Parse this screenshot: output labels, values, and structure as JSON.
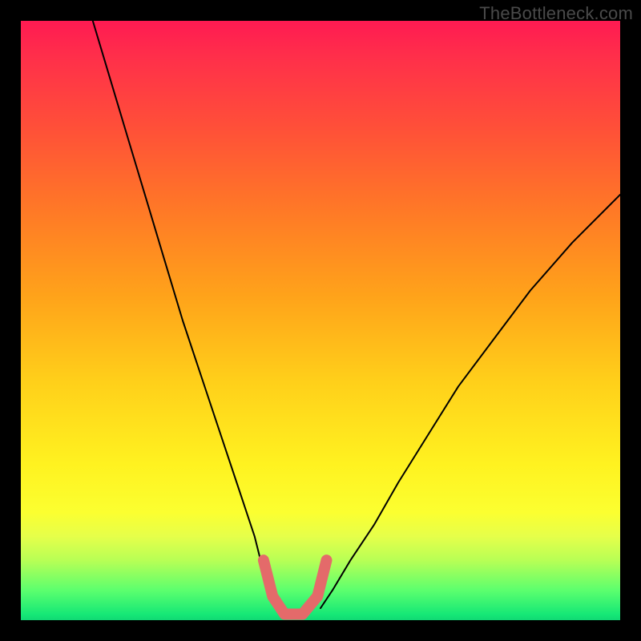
{
  "watermark": "TheBottleneck.com",
  "chart_data": {
    "type": "line",
    "title": "",
    "xlabel": "",
    "ylabel": "",
    "xlim": [
      0,
      100
    ],
    "ylim": [
      0,
      100
    ],
    "grid": false,
    "series": [
      {
        "name": "black-curve-left",
        "color": "#000000",
        "stroke_width": 2,
        "x": [
          12,
          15,
          18,
          21,
          24,
          27,
          30,
          33,
          36,
          39,
          41,
          42.5
        ],
        "values": [
          100,
          90,
          80,
          70,
          60,
          50,
          41,
          32,
          23,
          14,
          6,
          2
        ]
      },
      {
        "name": "black-curve-right",
        "color": "#000000",
        "stroke_width": 2,
        "x": [
          50,
          52,
          55,
          59,
          63,
          68,
          73,
          79,
          85,
          92,
          100
        ],
        "values": [
          2,
          5,
          10,
          16,
          23,
          31,
          39,
          47,
          55,
          63,
          71
        ]
      },
      {
        "name": "pink-highlight",
        "color": "#e46a6a",
        "stroke_width": 14,
        "x": [
          40.5,
          42,
          44,
          47,
          49.5,
          51
        ],
        "values": [
          10,
          4,
          1,
          1,
          4,
          10
        ]
      }
    ],
    "annotations": []
  }
}
